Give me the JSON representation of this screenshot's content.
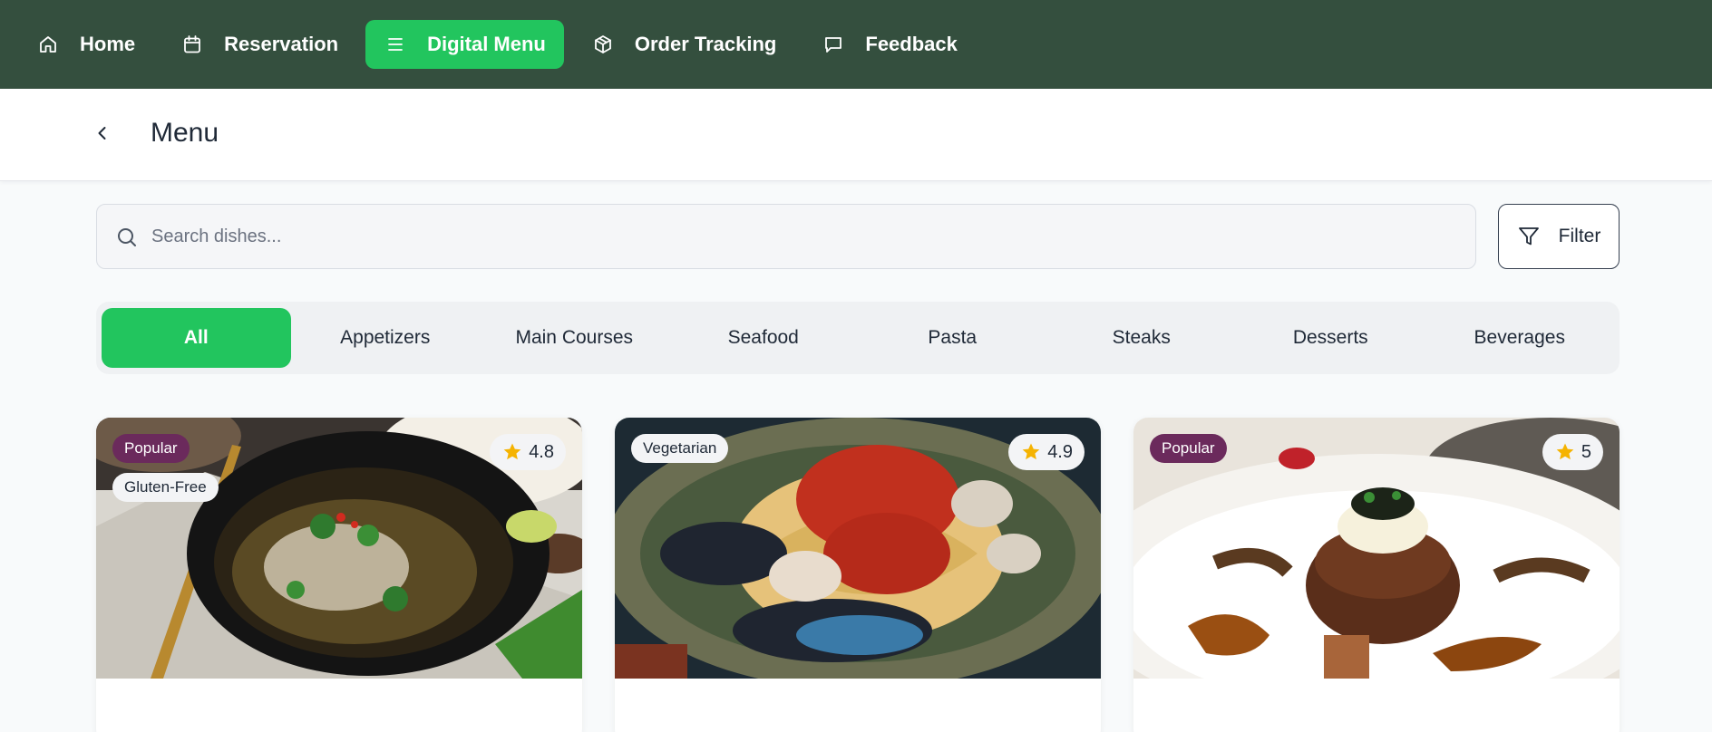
{
  "nav": {
    "items": [
      {
        "label": "Home",
        "icon": "home-icon",
        "active": false
      },
      {
        "label": "Reservation",
        "icon": "calendar-icon",
        "active": false
      },
      {
        "label": "Digital Menu",
        "icon": "menu-list-icon",
        "active": true
      },
      {
        "label": "Order Tracking",
        "icon": "package-icon",
        "active": false
      },
      {
        "label": "Feedback",
        "icon": "message-icon",
        "active": false
      }
    ]
  },
  "header": {
    "title": "Menu"
  },
  "search": {
    "placeholder": "Search dishes...",
    "value": ""
  },
  "filter": {
    "label": "Filter"
  },
  "categories": [
    {
      "label": "All",
      "active": true
    },
    {
      "label": "Appetizers",
      "active": false
    },
    {
      "label": "Main Courses",
      "active": false
    },
    {
      "label": "Seafood",
      "active": false
    },
    {
      "label": "Pasta",
      "active": false
    },
    {
      "label": "Steaks",
      "active": false
    },
    {
      "label": "Desserts",
      "active": false
    },
    {
      "label": "Beverages",
      "active": false
    }
  ],
  "cards": [
    {
      "badges": [
        "Popular",
        "Gluten-Free"
      ],
      "rating": "4.8"
    },
    {
      "badges": [
        "Vegetarian"
      ],
      "rating": "4.9"
    },
    {
      "badges": [
        "Popular"
      ],
      "rating": "5"
    }
  ],
  "colors": {
    "nav_bg": "#344f3e",
    "accent": "#22c55e",
    "popular_badge": "#6b2a5c",
    "star": "#f5b301"
  }
}
